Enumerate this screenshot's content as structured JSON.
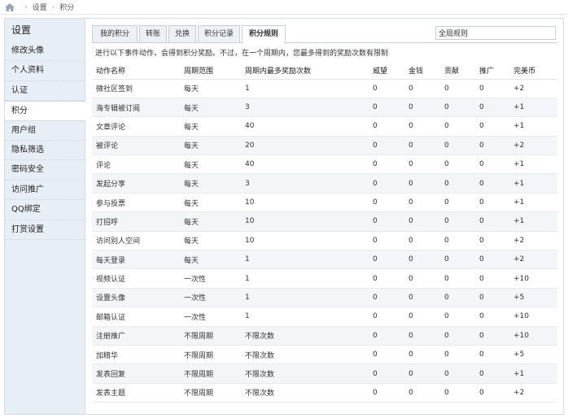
{
  "breadcrumb": {
    "items": [
      "设置",
      "积分"
    ]
  },
  "sidebar": {
    "title": "设置",
    "items": [
      {
        "label": "修改头像",
        "active": false
      },
      {
        "label": "个人资料",
        "active": false
      },
      {
        "label": "认证",
        "active": false
      },
      {
        "label": "积分",
        "active": true
      },
      {
        "label": "用户组",
        "active": false
      },
      {
        "label": "隐私筛选",
        "active": false
      },
      {
        "label": "密码安全",
        "active": false
      },
      {
        "label": "访问推广",
        "active": false
      },
      {
        "label": "QQ绑定",
        "active": false
      },
      {
        "label": "打赏设置",
        "active": false
      }
    ]
  },
  "tabs": [
    {
      "label": "我的积分",
      "active": false
    },
    {
      "label": "转账",
      "active": false
    },
    {
      "label": "兑换",
      "active": false
    },
    {
      "label": "积分记录",
      "active": false
    },
    {
      "label": "积分规则",
      "active": true
    }
  ],
  "search": {
    "value": "全局规则"
  },
  "notice": "进行以下事件动作，会得到积分奖励。不过，在一个周期内，您最多得到的奖励次数有限制",
  "table": {
    "headers": [
      "动作名称",
      "周期范围",
      "周期内最多奖励次数",
      "威望",
      "金钱",
      "贡献",
      "推广",
      "完美币"
    ],
    "rows": [
      [
        "微社区签到",
        "每天",
        "1",
        "0",
        "0",
        "0",
        "0",
        "+2"
      ],
      [
        "海专辑被订阅",
        "每天",
        "3",
        "0",
        "0",
        "0",
        "0",
        "+1"
      ],
      [
        "文章评论",
        "每天",
        "40",
        "0",
        "0",
        "0",
        "0",
        "+1"
      ],
      [
        "被评论",
        "每天",
        "20",
        "0",
        "0",
        "0",
        "0",
        "+2"
      ],
      [
        "评论",
        "每天",
        "40",
        "0",
        "0",
        "0",
        "0",
        "+1"
      ],
      [
        "发起分享",
        "每天",
        "3",
        "0",
        "0",
        "0",
        "0",
        "+1"
      ],
      [
        "参与投票",
        "每天",
        "10",
        "0",
        "0",
        "0",
        "0",
        "+1"
      ],
      [
        "打招呼",
        "每天",
        "10",
        "0",
        "0",
        "0",
        "0",
        "+1"
      ],
      [
        "访问别人空间",
        "每天",
        "10",
        "0",
        "0",
        "0",
        "0",
        "+2"
      ],
      [
        "每天登录",
        "每天",
        "1",
        "0",
        "0",
        "0",
        "0",
        "+2"
      ],
      [
        "视频认证",
        "一次性",
        "1",
        "0",
        "0",
        "0",
        "0",
        "+10"
      ],
      [
        "设置头像",
        "一次性",
        "1",
        "0",
        "0",
        "0",
        "0",
        "+5"
      ],
      [
        "邮箱认证",
        "一次性",
        "1",
        "0",
        "0",
        "0",
        "0",
        "+10"
      ],
      [
        "注册推广",
        "不限周期",
        "不限次数",
        "0",
        "0",
        "0",
        "0",
        "+10"
      ],
      [
        "加精华",
        "不限周期",
        "不限次数",
        "0",
        "0",
        "0",
        "0",
        "+5"
      ],
      [
        "发表回复",
        "不限周期",
        "不限次数",
        "0",
        "0",
        "0",
        "0",
        "+1"
      ],
      [
        "发表主题",
        "不限周期",
        "不限次数",
        "0",
        "0",
        "0",
        "0",
        "+2"
      ]
    ]
  },
  "colors": {
    "sidebar_bg": "#e8eef6",
    "alt_row": "#f3f5f8",
    "border": "#d6dbe2"
  }
}
